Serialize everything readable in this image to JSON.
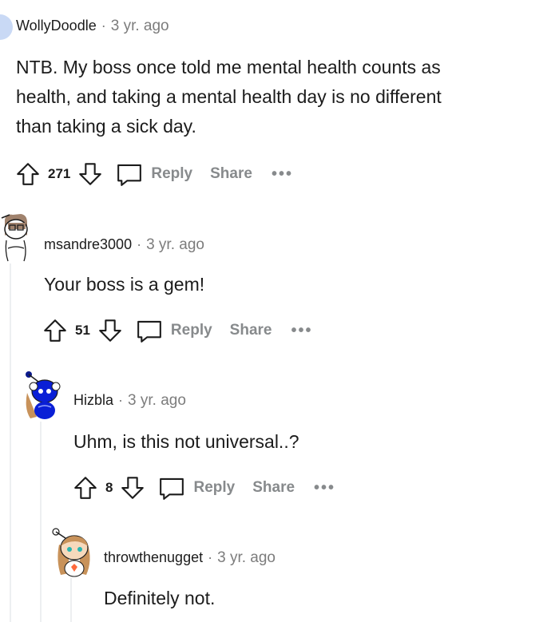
{
  "comments": [
    {
      "author": "WollyDoodle",
      "time": "3 yr. ago",
      "body_lines": [
        "NTB. My boss once told me mental health counts as",
        "health, and taking a mental health day is no different",
        "than taking a sick day."
      ],
      "score": "271",
      "reply_label": "Reply",
      "share_label": "Share",
      "more_label": "•••"
    },
    {
      "author": "msandre3000",
      "time": "3 yr. ago",
      "body": "Your boss is a gem!",
      "score": "51",
      "reply_label": "Reply",
      "share_label": "Share",
      "more_label": "•••"
    },
    {
      "author": "Hizbla",
      "time": "3 yr. ago",
      "body": "Uhm, is this not universal..?",
      "score": "8",
      "reply_label": "Reply",
      "share_label": "Share",
      "more_label": "•••"
    },
    {
      "author": "throwthenugget",
      "time": "3 yr. ago",
      "body": "Definitely not."
    }
  ],
  "separator": "·",
  "colors": {
    "meta_gray": "#7c7c7c",
    "action_gray": "#878a8c",
    "thread_line": "#edeff1"
  }
}
